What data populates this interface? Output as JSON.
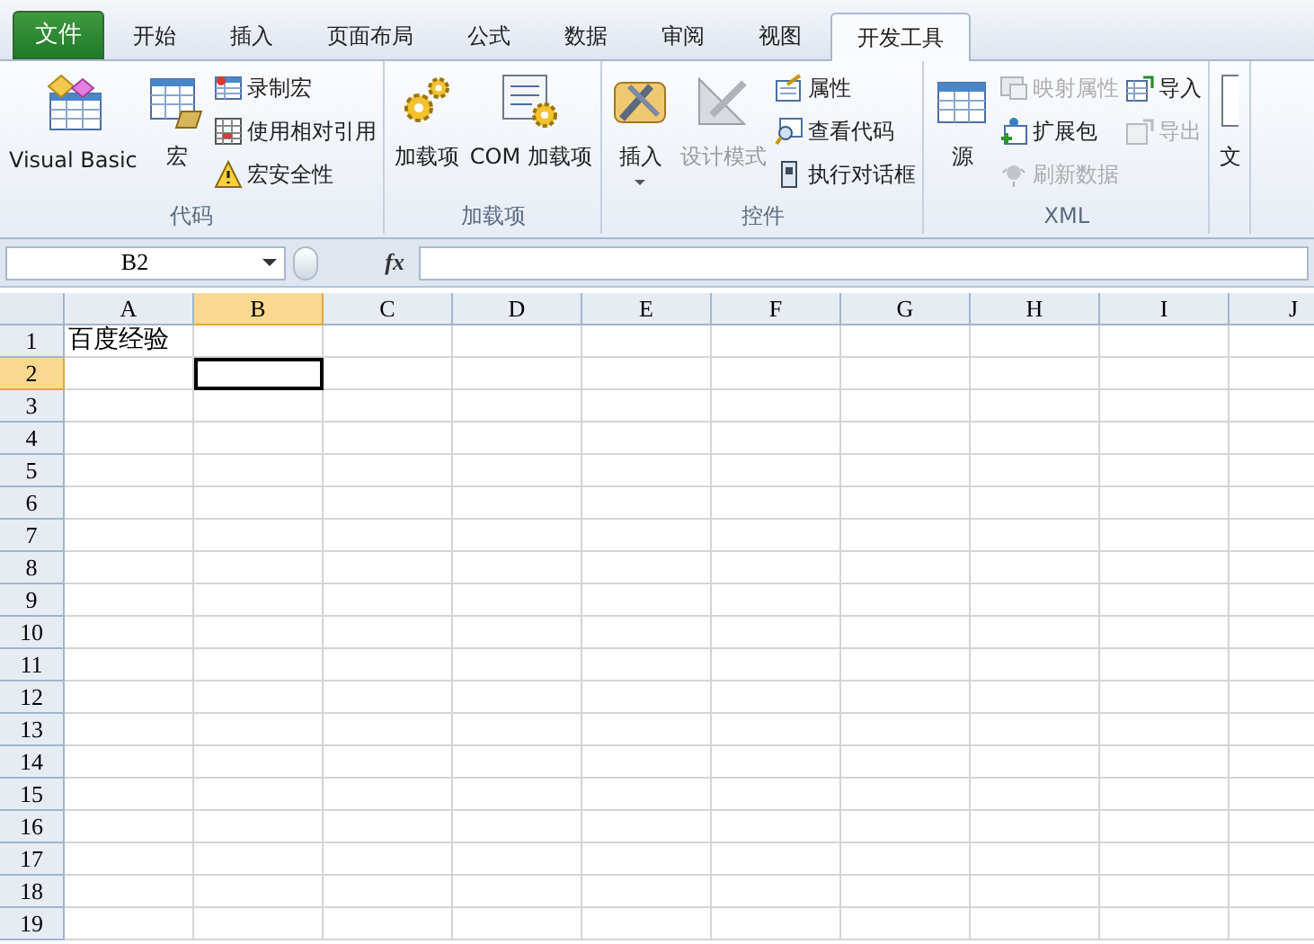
{
  "tabs": [
    {
      "label": "文件",
      "kind": "file",
      "selected": false
    },
    {
      "label": "开始",
      "kind": "tab",
      "selected": false
    },
    {
      "label": "插入",
      "kind": "tab",
      "selected": false
    },
    {
      "label": "页面布局",
      "kind": "tab",
      "selected": false
    },
    {
      "label": "公式",
      "kind": "tab",
      "selected": false
    },
    {
      "label": "数据",
      "kind": "tab",
      "selected": false
    },
    {
      "label": "审阅",
      "kind": "tab",
      "selected": false
    },
    {
      "label": "视图",
      "kind": "tab",
      "selected": false
    },
    {
      "label": "开发工具",
      "kind": "tab",
      "selected": true
    }
  ],
  "ribbon": {
    "groups": [
      {
        "label": "代码",
        "items": [
          {
            "label": "Visual Basic",
            "kind": "large",
            "disabled": false
          },
          {
            "label": "宏",
            "kind": "large",
            "disabled": false
          },
          {
            "label": "录制宏",
            "kind": "small",
            "disabled": false
          },
          {
            "label": "使用相对引用",
            "kind": "small",
            "disabled": false
          },
          {
            "label": "宏安全性",
            "kind": "small",
            "disabled": false
          }
        ]
      },
      {
        "label": "加载项",
        "items": [
          {
            "label": "加载项",
            "kind": "large",
            "disabled": false
          },
          {
            "label": "COM 加载项",
            "kind": "large",
            "disabled": false
          }
        ]
      },
      {
        "label": "控件",
        "items": [
          {
            "label": "插入",
            "kind": "dropdown",
            "disabled": false
          },
          {
            "label": "设计模式",
            "kind": "large",
            "disabled": true
          },
          {
            "label": "属性",
            "kind": "small",
            "disabled": false
          },
          {
            "label": "查看代码",
            "kind": "small",
            "disabled": false
          },
          {
            "label": "执行对话框",
            "kind": "small",
            "disabled": false
          }
        ]
      },
      {
        "label": "XML",
        "items": [
          {
            "label": "源",
            "kind": "large",
            "disabled": false
          },
          {
            "label": "映射属性",
            "kind": "small",
            "disabled": true
          },
          {
            "label": "扩展包",
            "kind": "small",
            "disabled": false
          },
          {
            "label": "刷新数据",
            "kind": "small",
            "disabled": true
          },
          {
            "label": "导入",
            "kind": "small",
            "disabled": false
          },
          {
            "label": "导出",
            "kind": "small",
            "disabled": true
          }
        ]
      },
      {
        "items": [
          {
            "label": "文",
            "kind": "large",
            "disabled": false
          }
        ]
      }
    ]
  },
  "formula_bar": {
    "name_box": "B2",
    "function_label": "fx"
  },
  "sheet": {
    "columns": [
      {
        "label": "A",
        "selected": false
      },
      {
        "label": "B",
        "selected": true
      },
      {
        "label": "C",
        "selected": false
      },
      {
        "label": "D",
        "selected": false
      },
      {
        "label": "E",
        "selected": false
      },
      {
        "label": "F",
        "selected": false
      },
      {
        "label": "G",
        "selected": false
      },
      {
        "label": "H",
        "selected": false
      },
      {
        "label": "I",
        "selected": false
      },
      {
        "label": "J",
        "selected": false
      }
    ],
    "rows": [
      {
        "label": "1",
        "selected": false,
        "cells": [
          "百度经验"
        ]
      },
      {
        "label": "2",
        "selected": true
      },
      {
        "label": "3",
        "selected": false
      },
      {
        "label": "4",
        "selected": false
      },
      {
        "label": "5",
        "selected": false
      },
      {
        "label": "6",
        "selected": false
      },
      {
        "label": "7",
        "selected": false
      },
      {
        "label": "8",
        "selected": false
      },
      {
        "label": "9",
        "selected": false
      },
      {
        "label": "10",
        "selected": false
      },
      {
        "label": "11",
        "selected": false
      },
      {
        "label": "12",
        "selected": false
      },
      {
        "label": "13",
        "selected": false
      },
      {
        "label": "14",
        "selected": false
      },
      {
        "label": "15",
        "selected": false
      },
      {
        "label": "16",
        "selected": false
      },
      {
        "label": "17",
        "selected": false
      },
      {
        "label": "18",
        "selected": false
      },
      {
        "label": "19",
        "selected": false
      }
    ]
  }
}
